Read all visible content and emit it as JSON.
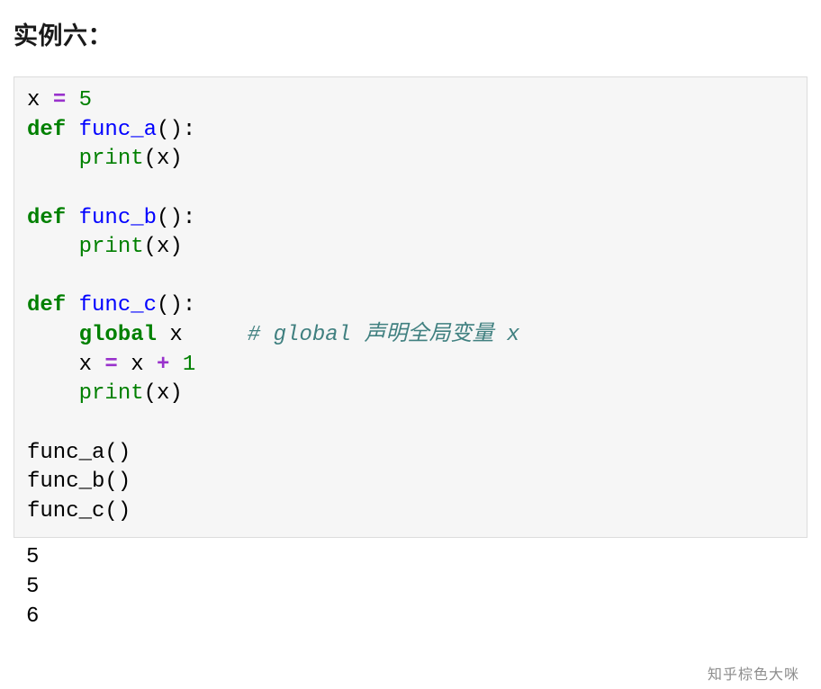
{
  "heading": "实例六：",
  "code": {
    "tokens": [
      {
        "text": "x ",
        "cls": ""
      },
      {
        "text": "=",
        "cls": "op"
      },
      {
        "text": " ",
        "cls": ""
      },
      {
        "text": "5",
        "cls": "num"
      },
      {
        "text": "\n",
        "cls": ""
      },
      {
        "text": "def",
        "cls": "kw"
      },
      {
        "text": " ",
        "cls": ""
      },
      {
        "text": "func_a",
        "cls": "fn"
      },
      {
        "text": "():\n",
        "cls": ""
      },
      {
        "text": "    ",
        "cls": ""
      },
      {
        "text": "print",
        "cls": "builtin"
      },
      {
        "text": "(x)\n",
        "cls": ""
      },
      {
        "text": "\n",
        "cls": ""
      },
      {
        "text": "def",
        "cls": "kw"
      },
      {
        "text": " ",
        "cls": ""
      },
      {
        "text": "func_b",
        "cls": "fn"
      },
      {
        "text": "():\n",
        "cls": ""
      },
      {
        "text": "    ",
        "cls": ""
      },
      {
        "text": "print",
        "cls": "builtin"
      },
      {
        "text": "(x)\n",
        "cls": ""
      },
      {
        "text": "\n",
        "cls": ""
      },
      {
        "text": "def",
        "cls": "kw"
      },
      {
        "text": " ",
        "cls": ""
      },
      {
        "text": "func_c",
        "cls": "fn"
      },
      {
        "text": "():\n",
        "cls": ""
      },
      {
        "text": "    ",
        "cls": ""
      },
      {
        "text": "global",
        "cls": "kw"
      },
      {
        "text": " x     ",
        "cls": ""
      },
      {
        "text": "# global 声明全局变量 x",
        "cls": "comment"
      },
      {
        "text": "\n",
        "cls": ""
      },
      {
        "text": "    x ",
        "cls": ""
      },
      {
        "text": "=",
        "cls": "op"
      },
      {
        "text": " x ",
        "cls": ""
      },
      {
        "text": "+",
        "cls": "op"
      },
      {
        "text": " ",
        "cls": ""
      },
      {
        "text": "1",
        "cls": "num"
      },
      {
        "text": "\n",
        "cls": ""
      },
      {
        "text": "    ",
        "cls": ""
      },
      {
        "text": "print",
        "cls": "builtin"
      },
      {
        "text": "(x)\n",
        "cls": ""
      },
      {
        "text": "\n",
        "cls": ""
      },
      {
        "text": "func_a()\n",
        "cls": ""
      },
      {
        "text": "func_b()\n",
        "cls": ""
      },
      {
        "text": "func_c()",
        "cls": ""
      }
    ]
  },
  "output": "5\n5\n6",
  "watermark": "知乎棕色大咪"
}
